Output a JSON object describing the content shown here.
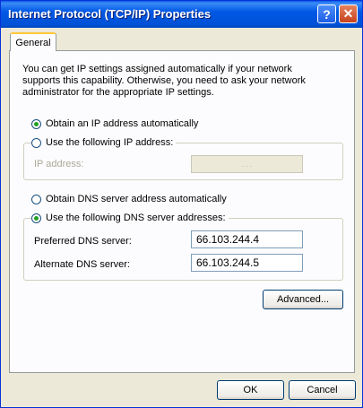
{
  "window": {
    "title": "Internet Protocol (TCP/IP) Properties",
    "help_label": "?",
    "close_label": "✕"
  },
  "tab": {
    "label": "General"
  },
  "intro": "You can get IP settings assigned automatically if your network supports this capability. Otherwise, you need to ask your network administrator for the appropriate IP settings.",
  "ip": {
    "auto_label": "Obtain an IP address automatically",
    "manual_label": "Use the following IP address:",
    "auto_selected": true,
    "address_label": "IP address:",
    "address_dots": ".       .       ."
  },
  "dns": {
    "auto_label": "Obtain DNS server address automatically",
    "manual_label": "Use the following DNS server addresses:",
    "manual_selected": true,
    "preferred_label": "Preferred DNS server:",
    "preferred_value": "66.103.244.4",
    "alternate_label": "Alternate DNS server:",
    "alternate_value": "66.103.244.5"
  },
  "buttons": {
    "advanced": "Advanced...",
    "ok": "OK",
    "cancel": "Cancel"
  }
}
